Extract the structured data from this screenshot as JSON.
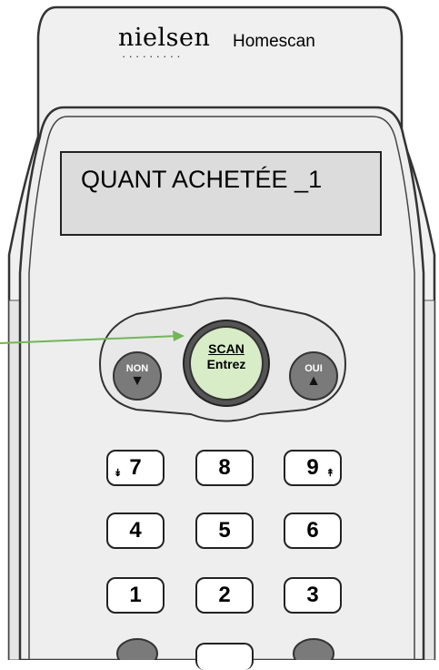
{
  "header": {
    "brand": "nielsen",
    "brand_dots": "·········",
    "product": "Homescan"
  },
  "display": {
    "text": "QUANT ACHETÉE _1"
  },
  "buttons": {
    "scan": "SCAN",
    "enter": "Entrez",
    "no": "NON",
    "yes": "OUI",
    "no_arrow": "▼",
    "yes_arrow": "▲"
  },
  "keypad": {
    "k7": "7",
    "k7_sub": "↡",
    "k8": "8",
    "k9": "9",
    "k9_sub": "↟",
    "k4": "4",
    "k5": "5",
    "k6": "6",
    "k1": "1",
    "k2": "2",
    "k3": "3"
  },
  "colors": {
    "pointer_arrow": "#74b556",
    "scan_button": "#d8ecc8",
    "lcd": "#dcdcdc",
    "body": "#eeeeee",
    "side_buttons": "#777777"
  }
}
